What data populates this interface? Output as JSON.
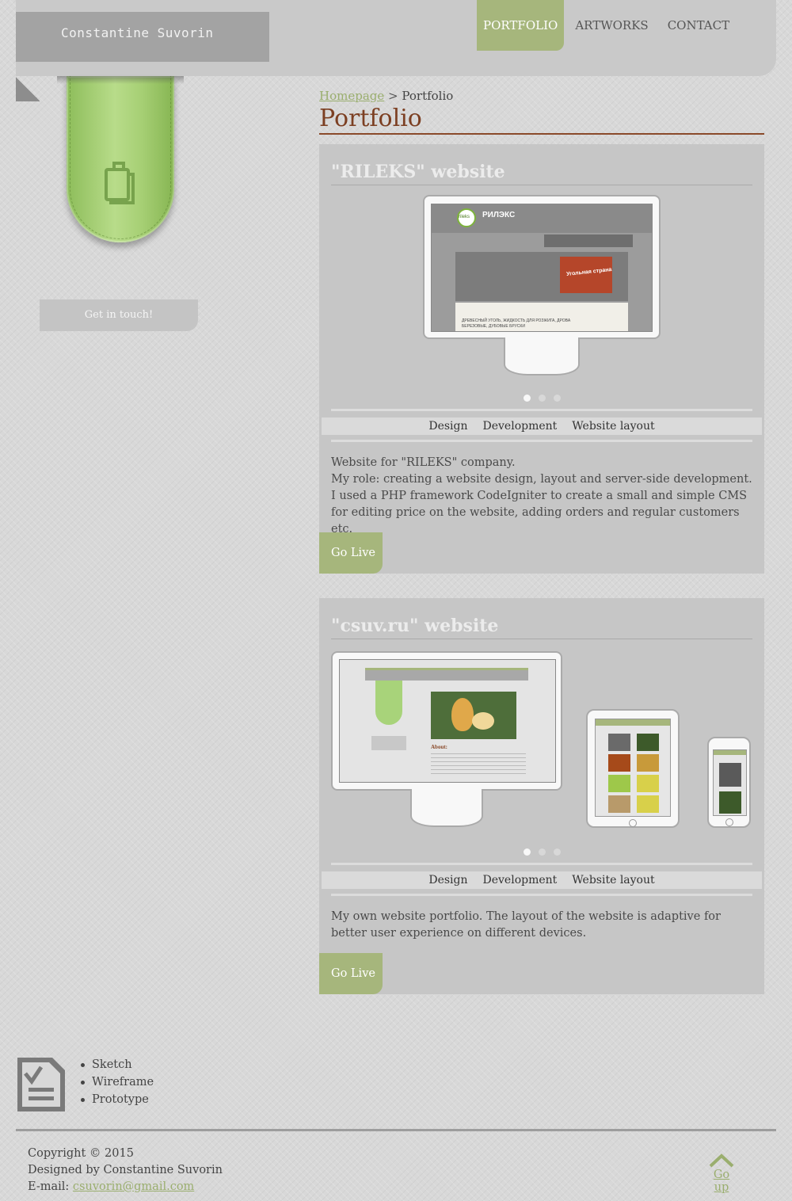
{
  "header": {
    "logo_text": "Constantine Suvorin",
    "nav": [
      {
        "label": "PORTFOLIO",
        "active": true
      },
      {
        "label": "ARTWORKS",
        "active": false
      },
      {
        "label": "CONTACT",
        "active": false
      }
    ]
  },
  "sidebar": {
    "ribbon_icon": "clipboard-icon",
    "button_label": "Get in touch!"
  },
  "breadcrumb": {
    "home_link": "Homepage",
    "separator": ">",
    "current": "Portfolio"
  },
  "page_title": "Portfolio",
  "projects": [
    {
      "title": "\"RILEKS\" website",
      "slides_total": 3,
      "active_slide": 1,
      "tags": [
        "Design",
        "Development",
        "Website layout"
      ],
      "description_lines": [
        "Website for \"RILEKS\" company.",
        "My role: creating a website design, layout and server-side development. I used a PHP framework CodeIgniter to create a small and simple CMS for editing price on the website, adding orders and regular customers etc."
      ],
      "button_label": "Go Live",
      "screenshot": {
        "brand": "rileks",
        "title_ru": "РИЛЭКС",
        "banner_text": "Угольная страна",
        "body_text": "ДРЕВЕСНЫЙ УГОЛЬ, ЖИДКОСТЬ ДЛЯ РОЗЖИГА, ДРОВА БЕРЕЗОВЫЕ, ДУБОВЫЕ БРУСКИ"
      }
    },
    {
      "title": "\"csuv.ru\" website",
      "slides_total": 3,
      "active_slide": 1,
      "tags": [
        "Design",
        "Development",
        "Website layout"
      ],
      "description_lines": [
        "My own website portfolio. The layout of the website is adaptive for better user experience on different devices."
      ],
      "button_label": "Go Live",
      "screenshot": {
        "heading": "About:"
      }
    }
  ],
  "sketch_list": [
    "Sketch",
    "Wireframe",
    "Prototype"
  ],
  "footer": {
    "copyright": "Copyright © 2015",
    "designed_by": "Designed by Constantine Suvorin",
    "email_label": "E-mail:",
    "email": "csuvorin@gmail.com",
    "go_up_label": "Go up"
  },
  "colors": {
    "accent_green": "#a6b67c",
    "title_brown": "#7c3f22",
    "link_green": "#9aae6e",
    "card_bg": "#c6c6c6"
  }
}
